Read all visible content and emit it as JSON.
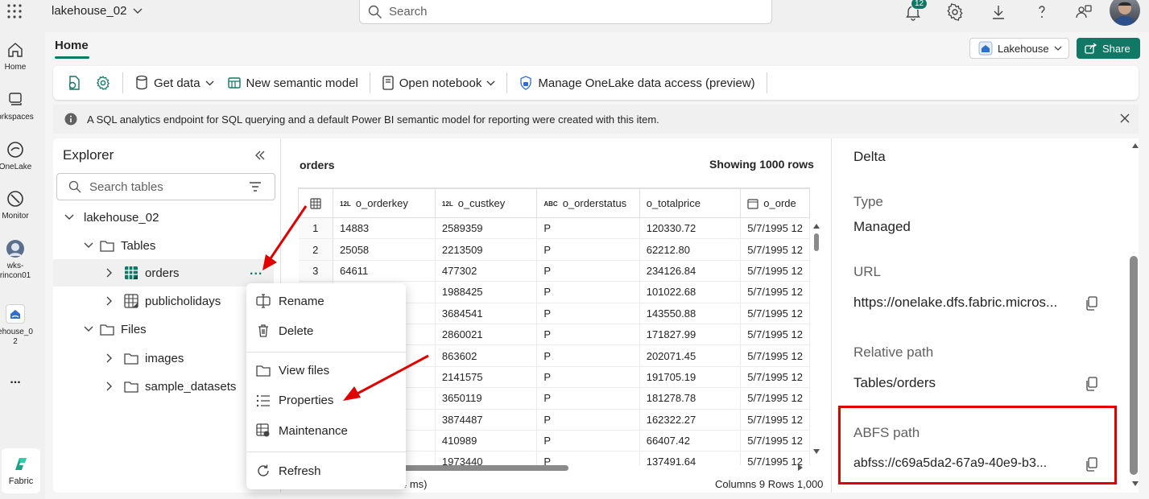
{
  "topbar": {
    "workspace_name": "lakehouse_02",
    "search_placeholder": "Search",
    "notification_count": "12"
  },
  "rail": {
    "home": "Home",
    "workspaces": "orkspaces",
    "onelake": "OneLake",
    "monitor": "Monitor",
    "wks_line1": "wks-",
    "wks_line2": "rincon01",
    "lakehouse_line1": "ehouse_0",
    "lakehouse_line2": "2",
    "more": "...",
    "fabric": "Fabric"
  },
  "header": {
    "tab_home": "Home",
    "item_type": "Lakehouse",
    "share": "Share"
  },
  "ribbon": {
    "get_data": "Get data",
    "new_semantic_model": "New semantic model",
    "open_notebook": "Open notebook",
    "manage_onelake": "Manage OneLake data access (preview)"
  },
  "infobar": {
    "message": "A SQL analytics endpoint for SQL querying and a default Power BI semantic model for reporting were created with this item."
  },
  "explorer": {
    "title": "Explorer",
    "search_placeholder": "Search tables",
    "lakehouse": "lakehouse_02",
    "tables_folder": "Tables",
    "table_orders": "orders",
    "table_publicholidays": "publicholidays",
    "files_folder": "Files",
    "folder_images": "images",
    "folder_sample": "sample_datasets",
    "more": "..."
  },
  "context_menu": {
    "rename": "Rename",
    "delete": "Delete",
    "view_files": "View files",
    "properties": "Properties",
    "maintenance": "Maintenance",
    "refresh": "Refresh"
  },
  "grid": {
    "table_name": "orders",
    "showing": "Showing 1000 rows",
    "columns": [
      {
        "type": "12L",
        "name": "o_orderkey"
      },
      {
        "type": "12L",
        "name": "o_custkey"
      },
      {
        "type": "ABC",
        "name": "o_orderstatus"
      },
      {
        "type": "",
        "name": "o_totalprice"
      },
      {
        "type": "cal",
        "name": "o_orde"
      }
    ],
    "rows": [
      [
        "1",
        "14883",
        "2589359",
        "P",
        "120330.72",
        "5/7/1995 12"
      ],
      [
        "2",
        "25058",
        "2213509",
        "P",
        "62212.80",
        "5/7/1995 12"
      ],
      [
        "3",
        "64611",
        "477302",
        "P",
        "234126.84",
        "5/7/1995 12"
      ],
      [
        "",
        "",
        "1988425",
        "P",
        "101022.68",
        "5/7/1995 12"
      ],
      [
        "",
        "",
        "3684541",
        "P",
        "143550.88",
        "5/7/1995 12"
      ],
      [
        "",
        "",
        "2860021",
        "P",
        "171827.99",
        "5/7/1995 12"
      ],
      [
        "",
        "",
        "863602",
        "P",
        "202071.45",
        "5/7/1995 12"
      ],
      [
        "",
        "",
        "2141575",
        "P",
        "191705.19",
        "5/7/1995 12"
      ],
      [
        "",
        "",
        "3650119",
        "P",
        "181278.78",
        "5/7/1995 12"
      ],
      [
        "",
        "",
        "3874487",
        "P",
        "162322.27",
        "5/7/1995 12"
      ],
      [
        "",
        "",
        "410989",
        "P",
        "66407.42",
        "5/7/1995 12"
      ],
      [
        "",
        "",
        "1973440",
        "P",
        "137491.64",
        "5/7/1995 12"
      ]
    ],
    "status_fragment": "4 ms)",
    "footer": "Columns 9 Rows 1,000"
  },
  "properties": {
    "format_value": "Delta",
    "type_label": "Type",
    "type_value": "Managed",
    "url_label": "URL",
    "url_value": "https://onelake.dfs.fabric.micros...",
    "relpath_label": "Relative path",
    "relpath_value": "Tables/orders",
    "abfs_label": "ABFS path",
    "abfs_value": "abfss://c69a5da2-67a9-40e9-b3..."
  },
  "colors": {
    "accent": "#117865",
    "highlight_box": "#e00000",
    "arrow": "#e00000"
  }
}
